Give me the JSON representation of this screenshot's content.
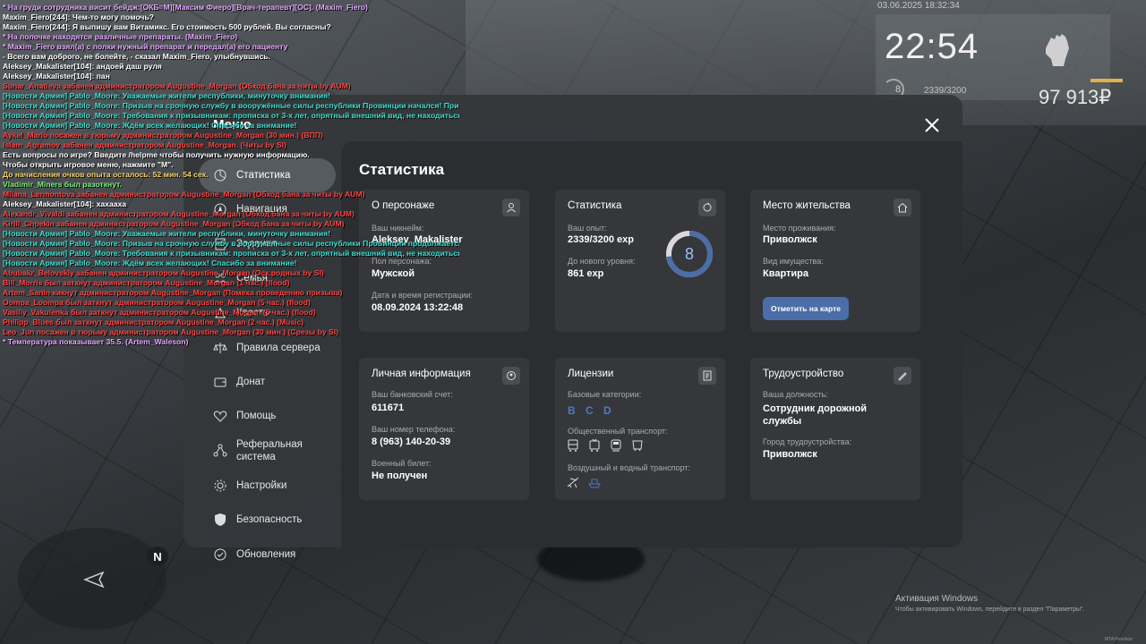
{
  "hud": {
    "datetime": "03.06.2025 18:32:34",
    "time": "22:54",
    "level": "8",
    "exp": "2339/3200",
    "money": "97 913₽"
  },
  "chat": [
    {
      "text": "* На груди сотрудника висит бейдж:[ОКБ=М][Максим Фиеро][Врач-терапевт][ОС]. (Maxim_Fiero)",
      "color": "#e5a6ff"
    },
    {
      "text": "Maxim_Fiero[244]: Чем-то могу помочь?",
      "color": "#ffffff"
    },
    {
      "text": "Maxim_Fiero[244]: Я выпишу вам Витамикс. Его стоимость 500 рублей. Вы согласны?",
      "color": "#ffffff"
    },
    {
      "text": "* На полочке находятся различные препараты. (Maxim_Fiero)",
      "color": "#e5a6ff"
    },
    {
      "text": "* Maxim_Fiero взял(а) с полки нужный препарат и передал(а) его пациенту",
      "color": "#e5a6ff"
    },
    {
      "text": "- Всего вам доброго, не болейте, - сказал Maxim_Fiero, улыбнувшись.",
      "color": "#ffffff"
    },
    {
      "text": "Aleksey_Makalister[104]: андоей даш руля",
      "color": "#ffffff"
    },
    {
      "text": "Aleksey_Makalister[104]: пан",
      "color": "#ffffff"
    },
    {
      "text": "Sunar_Anatieva забанен администратором Augustine_Morgan (Обход бана за читы by AUM)",
      "color": "#ff4444"
    },
    {
      "text": "[Новости Армия] Pablo_Moore: Уважаемые жители республики, минуточку внимания!",
      "color": "#3fe0d0"
    },
    {
      "text": "[Новости Армия] Pablo_Moore: Призыв на срочную службу в вооружённые силы республики Провинции начался! Призы",
      "color": "#3fe0d0"
    },
    {
      "text": "[Новости Армия] Pablo_Moore: Требования к призывникам: прописка от 3-х лет, опрятный внешний вид, не находиться в",
      "color": "#3fe0d0"
    },
    {
      "text": "[Новости Армия] Pablo_Moore: Ждём всех желающих! Спасибо за внимание!",
      "color": "#3fe0d0"
    },
    {
      "text": "Aykel_Marlo посажен в тюрьму администратором Augustine_Morgan (30 мин.) (ВПП)",
      "color": "#ff4444"
    },
    {
      "text": "Islam_Agramov забанен администратором Augustine_Morgan. (Читы by SI)",
      "color": "#ff4444"
    },
    {
      "text": "Есть вопросы по игре? Введите /helpme чтобы получить нужную информацию.",
      "color": "#ffffff"
    },
    {
      "text": "Чтобы открыть игровое меню, нажмите \"M\".",
      "color": "#ffffff"
    },
    {
      "text": "До начисления очков опыта осталось: 52 мин. 54 сек.",
      "color": "#f6d56a"
    },
    {
      "text": "Vladimir_Miners был разоткнут.",
      "color": "#7cf07c"
    },
    {
      "text": "Milana_Lermontova забанен администратором Augustine_Morgan (Обход бана за читы by AUM)",
      "color": "#ff4444"
    },
    {
      "text": "Aleksey_Makalister[104]: хахааха",
      "color": "#ffffff"
    },
    {
      "text": "Alexandr_Vivaldi забанен администратором Augustine_Morgan (Обход бана за читы by AUM)",
      "color": "#ff4444"
    },
    {
      "text": "Kirill_Chpekin забанен администратором Augustine_Morgan (Обход бана за читы by AUM)",
      "color": "#ff4444"
    },
    {
      "text": "[Новости Армия] Pablo_Moore: Уважаемые жители республики, минуточку внимания!",
      "color": "#3fe0d0"
    },
    {
      "text": "[Новости Армия] Pablo_Moore: Призыв на срочную службу в вооружённые силы республики Провинции продолжается!",
      "color": "#3fe0d0"
    },
    {
      "text": "[Новости Армия] Pablo_Moore: Требования к призывникам: прописка от 3-х лет, опрятный внешний вид, не находиться в",
      "color": "#3fe0d0"
    },
    {
      "text": "[Новости Армия] Pablo_Moore: Ждём всех желающих! Спасибо за внимание!",
      "color": "#3fe0d0"
    },
    {
      "text": "Abubakr_Belovskiy забанен администратором Augustine_Morgan (Оск.родных by SI)",
      "color": "#ff4444"
    },
    {
      "text": "Bill_Morris был заткнут администратором Augustine_Morgan (1 час.) (flood)",
      "color": "#ff4444"
    },
    {
      "text": "Artem_Sanin кикнут администратором Augustine_Morgan (Помеха проведению призыва)",
      "color": "#ff4444"
    },
    {
      "text": "Oompa_Loompa был заткнут администратором Augustine_Morgan (5 час.) (flood)",
      "color": "#ff4444"
    },
    {
      "text": "Vasiliy_Vakulenka был заткнут администратором Augustine_Morgan (5 час.) (flood)",
      "color": "#ff4444"
    },
    {
      "text": "Philipp_Blues был заткнут администратором Augustine_Morgan (2 час.) (Music)",
      "color": "#ff4444"
    },
    {
      "text": "Leo_Jun посажен в тюрьму администратором Augustine_Morgan (30 мин.) (Срезы by SI)",
      "color": "#ff4444"
    },
    {
      "text": "* Температура показывает 35.5. (Artem_Waleson)",
      "color": "#e5a6ff"
    }
  ],
  "menu": {
    "title": "Меню",
    "sidebar": [
      {
        "label": "Статистика",
        "icon": "chart-icon",
        "active": true
      },
      {
        "label": "Навигация",
        "icon": "compass-icon",
        "active": false
      },
      {
        "label": "Задания",
        "icon": "task-icon",
        "active": false
      },
      {
        "label": "Семья",
        "icon": "family-icon",
        "active": false
      },
      {
        "label": "Квесты",
        "icon": "quest-icon",
        "active": false
      },
      {
        "label": "Правила сервера",
        "icon": "rules-icon",
        "active": false
      },
      {
        "label": "Донат",
        "icon": "wallet-icon",
        "active": false
      },
      {
        "label": "Помощь",
        "icon": "heart-icon",
        "active": false
      },
      {
        "label": "Реферальная система",
        "icon": "referral-icon",
        "active": false
      },
      {
        "label": "Настройки",
        "icon": "gear-icon",
        "active": false
      },
      {
        "label": "Безопасность",
        "icon": "shield-icon",
        "active": false
      },
      {
        "label": "Обновления",
        "icon": "update-icon",
        "active": false
      }
    ]
  },
  "stats": {
    "title": "Статистика",
    "character": {
      "title": "О персонаже",
      "nick_label": "Ваш никнейм:",
      "nick": "Aleksey_Makalister",
      "gender_label": "Пол персонажа:",
      "gender": "Мужской",
      "reg_label": "Дата и время регистрации:",
      "reg": "08.09.2024 13:22:48"
    },
    "statistics": {
      "title": "Статистика",
      "exp_label": "Ваш опыт:",
      "exp": "2339/3200 exp",
      "next_label": "До нового уровня:",
      "next": "861 exp",
      "level": "8",
      "progress": 0.73
    },
    "residence": {
      "title": "Место жительства",
      "place_label": "Место проживания:",
      "place": "Приволжск",
      "property_label": "Вид имущества:",
      "property": "Квартира",
      "map_button": "Отметить на карте"
    },
    "personal": {
      "title": "Личная информация",
      "bank_label": "Ваш банковский счет:",
      "bank": "611671",
      "phone_label": "Ваш номер телефона:",
      "phone": "8 (963) 140-20-39",
      "military_label": "Военный билет:",
      "military": "Не получен"
    },
    "licenses": {
      "title": "Лицензии",
      "base_label": "Базовые категории:",
      "base": "B  C  D",
      "public_label": "Общественный транспорт:",
      "air_label": "Воздушный и водный транспорт:"
    },
    "employment": {
      "title": "Трудоустройство",
      "position_label": "Ваша должность:",
      "position": "Сотрудник дорожной службы",
      "city_label": "Город трудоустройства:",
      "city": "Приволжск"
    }
  },
  "minimap": {
    "north": "N"
  },
  "windows": {
    "activate": "Активация Windows",
    "hint": "Чтобы активировать Windows, перейдите в раздел \"Параметры\"."
  },
  "watermark": "MTA Province"
}
